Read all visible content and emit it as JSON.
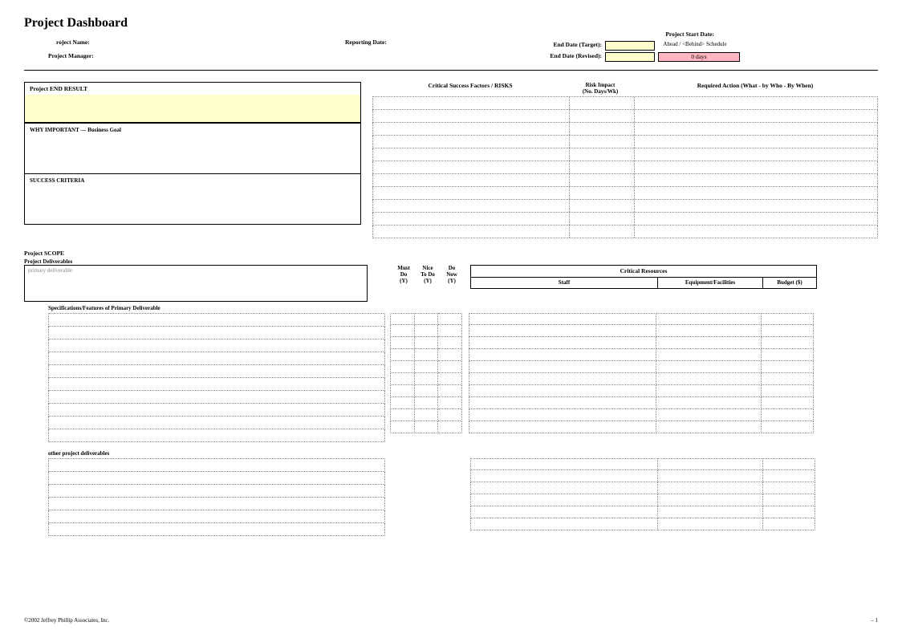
{
  "title": "Project Dashboard",
  "header": {
    "project_name_label": "roject Name:",
    "reporting_date_label": "Reporting Date:",
    "project_start_label": "Project Start Date:",
    "end_date_target_label": "End Date (Target):",
    "schedule_status_label": "Ahead / <Behind> Schedule",
    "project_manager_label": "Project Manager:",
    "end_date_revised_label": "End Date (Revised):",
    "days_value": "0 days"
  },
  "left": {
    "end_result": "Project END RESULT",
    "business_goal": "WHY IMPORTANT  —  Business Goal",
    "success_criteria": "SUCCESS CRITERIA"
  },
  "risks": {
    "csf_label": "Critical Success Factors  /  RISKS",
    "impact_label": "Risk Impact\n(No. Days/Wk)",
    "action_label": "Required Action  (What - by Who - By When)"
  },
  "scope": {
    "title": "Project SCOPE",
    "deliverables_label": "Project Deliverables",
    "primary_placeholder": "primary deliverable",
    "must_do": "Must\nDo\n(Y)",
    "nice_to_do": "Nice\nTo Do\n(Y)",
    "do_now": "Do\nNow\n(Y)",
    "spec_label": "Specifications/Features of Primary Deliverable",
    "other_label": "other project deliverables"
  },
  "resources": {
    "title": "Critical Resources",
    "staff": "Staff",
    "equipment": "Equipment/Facilities",
    "budget": "Budget ($)"
  },
  "footer": {
    "copyright": "©2002 Jeffrey Phillip Associates, Inc.",
    "page": "–  1"
  }
}
